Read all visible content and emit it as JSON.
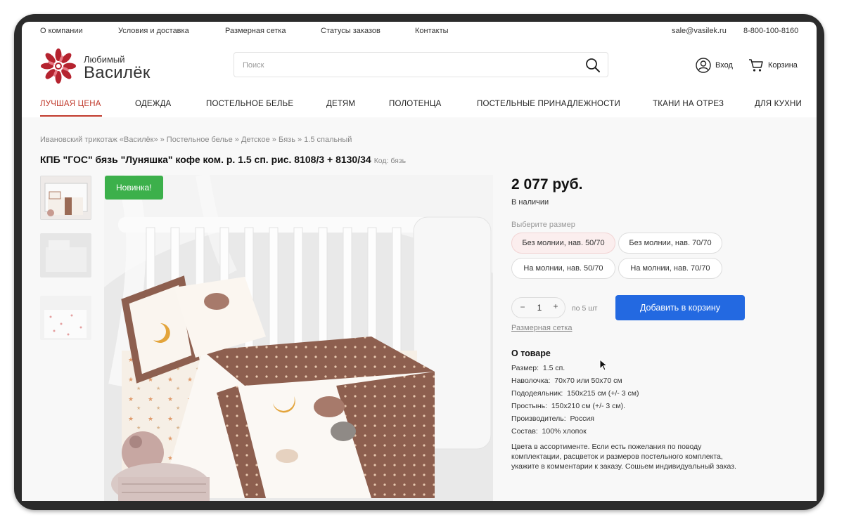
{
  "topbar": {
    "links": [
      "О компании",
      "Условия и доставка",
      "Размерная сетка",
      "Статусы заказов",
      "Контакты"
    ],
    "email": "sale@vasilek.ru",
    "phone": "8-800-100-8160"
  },
  "header": {
    "logo_small": "Любимый",
    "logo_big": "Василёк",
    "search_placeholder": "Поиск",
    "login_label": "Вход",
    "cart_label": "Корзина"
  },
  "nav": {
    "items": [
      "ЛУЧШАЯ ЦЕНА",
      "ОДЕЖДА",
      "ПОСТЕЛЬНОЕ БЕЛЬЕ",
      "ДЕТЯМ",
      "ПОЛОТЕНЦА",
      "ПОСТЕЛЬНЫЕ ПРИНАДЛЕЖНОСТИ",
      "ТКАНИ НА ОТРЕЗ",
      "ДЛЯ КУХНИ"
    ],
    "active": "ЛУЧШАЯ ЦЕНА"
  },
  "breadcrumb": {
    "items": [
      "Ивановский трикотаж «Василёк»",
      "Постельное белье",
      "Детское",
      "Бязь",
      "1.5 спальный"
    ],
    "separator": " » "
  },
  "product": {
    "title": "КПБ \"ГОС\" бязь \"Луняшка\" кофе ком. р. 1.5 сп. рис. 8108/3 + 8130/34",
    "code": "Код: бязь",
    "badge": "Новинка!",
    "price": "2 077 руб.",
    "stock": "В наличии",
    "size_label": "Выберите размер",
    "sizes": [
      "Без молнии, нав. 50/70",
      "Без молнии, нав. 70/70",
      "На молнии, нав. 50/70",
      "На молнии, нав. 70/70"
    ],
    "selected_size": "Без молнии, нав. 50/70",
    "quantity": {
      "minus": "−",
      "value": "1",
      "plus": "+",
      "per": "по 5 шт"
    },
    "add_to_cart": "Добавить в корзину",
    "size_chart_link": "Размерная сетка",
    "about_heading": "О товаре",
    "specs": [
      {
        "label": "Размер:",
        "value": "1.5 сп."
      },
      {
        "label": "Наволочка:",
        "value": "70х70 или 50х70 см"
      },
      {
        "label": "Пододеяльник:",
        "value": "150х215 см (+/- 3 см)"
      },
      {
        "label": "Простынь:",
        "value": "150х210 см (+/- 3 см)."
      },
      {
        "label": "Производитель:",
        "value": "Россия"
      },
      {
        "label": "Состав:",
        "value": "100% хлопок"
      }
    ],
    "description": "Цвета в ассортименте. Если есть пожелания по поводу комплектации, расцветок и размеров постельного комплекта, укажите в комментарии к заказу. Сошьем индивидуальный заказ."
  },
  "colors": {
    "accent_red": "#c0392b",
    "button_blue": "#2369e1",
    "badge_green": "#3cb04b"
  }
}
